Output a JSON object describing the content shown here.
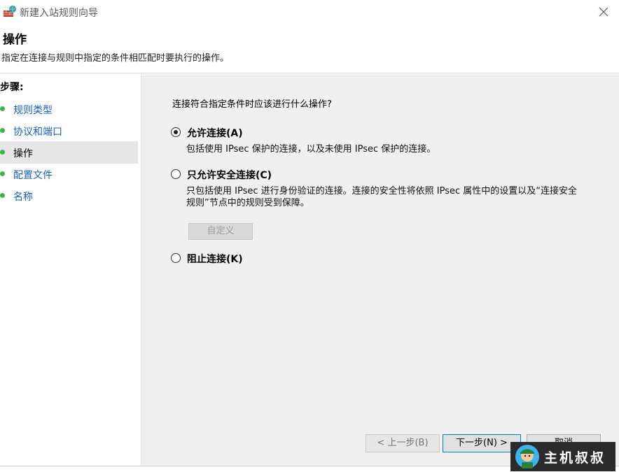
{
  "window": {
    "title": "新建入站规则向导"
  },
  "header": {
    "title": "操作",
    "subtitle": "指定在连接与规则中指定的条件相匹配时要执行的操作。"
  },
  "sidebar": {
    "heading": "步骤:",
    "items": [
      {
        "label": "规则类型",
        "active": false
      },
      {
        "label": "协议和端口",
        "active": false
      },
      {
        "label": "操作",
        "active": true
      },
      {
        "label": "配置文件",
        "active": false
      },
      {
        "label": "名称",
        "active": false
      }
    ]
  },
  "main": {
    "question": "连接符合指定条件时应该进行什么操作?",
    "options": [
      {
        "label": "允许连接(A)",
        "description": "包括使用 IPsec 保护的连接，以及未使用 IPsec 保护的连接。",
        "checked": true
      },
      {
        "label": "只允许安全连接(C)",
        "description": "只包括使用 IPsec 进行身份验证的连接。连接的安全性将依照 IPsec 属性中的设置以及“连接安全规则”节点中的规则受到保障。",
        "checked": false
      },
      {
        "label": "阻止连接(K)",
        "description": "",
        "checked": false
      }
    ],
    "customize_label": "自定义"
  },
  "footer": {
    "back_label": "< 上一步(B)",
    "next_label": "下一步(N) >",
    "cancel_label": "取消"
  },
  "watermark": {
    "text": "主机叔叔"
  },
  "colors": {
    "link": "#1a5fb4",
    "step_dot": "#39b54a",
    "primary_border": "#0078d7",
    "content_bg": "#f0f0f0"
  },
  "icons": {
    "app": "firewall-icon",
    "close": "close-icon",
    "step": "step-dot-icon"
  }
}
